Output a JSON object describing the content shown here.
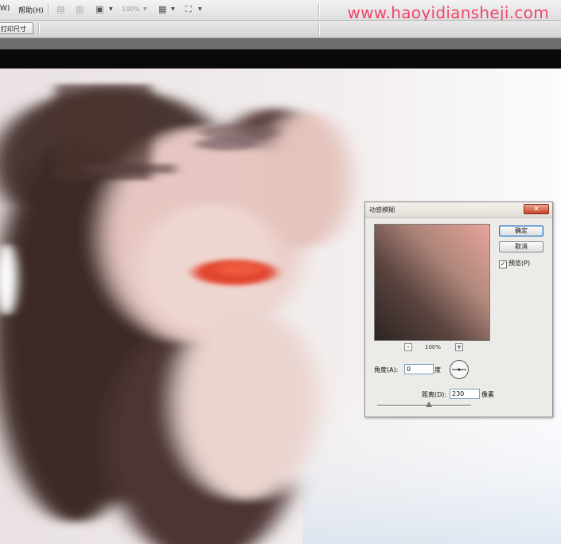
{
  "menubar": {
    "partial_item": "W)",
    "help_item": "帮助(H)",
    "zoom_value": "100%",
    "watermark": "www.haoyidiansheji.com"
  },
  "options_bar": {
    "print_size_button": "打印尺寸"
  },
  "dialog": {
    "title": "动感模糊",
    "close_symbol": "✕",
    "ok_label": "确定",
    "cancel_label": "取消",
    "preview_label": "预览(P)",
    "preview_checked": true,
    "zoom_out_symbol": "-",
    "zoom_in_symbol": "+",
    "zoom_value": "100%",
    "angle_label": "角度(A):",
    "angle_value": "0",
    "angle_unit": "度",
    "distance_label": "距离(D):",
    "distance_value": "230",
    "distance_unit": "像素"
  },
  "colors": {
    "watermark": "#f1456a",
    "ok_border": "#3d7ab8",
    "close_button": "#c9442a"
  }
}
